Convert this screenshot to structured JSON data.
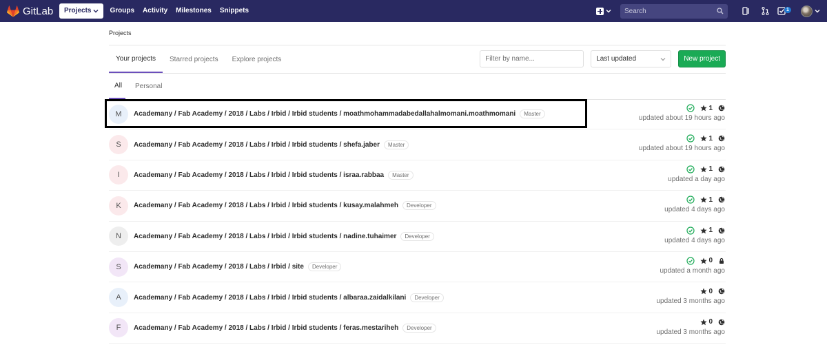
{
  "navbar": {
    "brand": "GitLab",
    "links": [
      "Projects",
      "Groups",
      "Activity",
      "Milestones",
      "Snippets"
    ],
    "search_placeholder": "Search",
    "todo_count": "1",
    "colors": {
      "bg": "#292961",
      "accent": "#fc6d26"
    }
  },
  "breadcrumb": "Projects",
  "tabs": [
    "Your projects",
    "Starred projects",
    "Explore projects"
  ],
  "filter": {
    "placeholder": "Filter by name...",
    "sort_value": "Last updated",
    "new_button": "New project"
  },
  "subtabs": [
    "All",
    "Personal"
  ],
  "projects": [
    {
      "initial": "M",
      "avatar_color": "#e8f0fa",
      "name": "Academany / Fab Academy / 2018 / Labs / Irbid / Irbid students / moathmohammadabedallahalmomani.moathmomani",
      "role": "Master",
      "pipeline": true,
      "stars": "1",
      "visibility": "public",
      "updated": "updated about 19 hours ago"
    },
    {
      "initial": "S",
      "avatar_color": "#fbe9eb",
      "name": "Academany / Fab Academy / 2018 / Labs / Irbid / Irbid students / shefa.jaber",
      "role": "Master",
      "pipeline": true,
      "stars": "1",
      "visibility": "public",
      "updated": "updated about 19 hours ago"
    },
    {
      "initial": "I",
      "avatar_color": "#fbe9eb",
      "name": "Academany / Fab Academy / 2018 / Labs / Irbid / Irbid students / israa.rabbaa",
      "role": "Master",
      "pipeline": true,
      "stars": "1",
      "visibility": "public",
      "updated": "updated a day ago"
    },
    {
      "initial": "K",
      "avatar_color": "#fbe9eb",
      "name": "Academany / Fab Academy / 2018 / Labs / Irbid / Irbid students / kusay.malahmeh",
      "role": "Developer",
      "pipeline": true,
      "stars": "1",
      "visibility": "public",
      "updated": "updated 4 days ago"
    },
    {
      "initial": "N",
      "avatar_color": "#eeeeee",
      "name": "Academany / Fab Academy / 2018 / Labs / Irbid / Irbid students / nadine.tuhaimer",
      "role": "Developer",
      "pipeline": true,
      "stars": "1",
      "visibility": "public",
      "updated": "updated 4 days ago"
    },
    {
      "initial": "S",
      "avatar_color": "#f2e6f7",
      "name": "Academany / Fab Academy / 2018 / Labs / Irbid / site",
      "role": "Developer",
      "pipeline": true,
      "stars": "0",
      "visibility": "private",
      "updated": "updated a month ago"
    },
    {
      "initial": "A",
      "avatar_color": "#e8f0fa",
      "name": "Academany / Fab Academy / 2018 / Labs / Irbid / Irbid students / albaraa.zaidalkilani",
      "role": "Developer",
      "pipeline": false,
      "stars": "0",
      "visibility": "public",
      "updated": "updated 3 months ago"
    },
    {
      "initial": "F",
      "avatar_color": "#f2e6f7",
      "name": "Academany / Fab Academy / 2018 / Labs / Irbid / Irbid students / feras.mestariheh",
      "role": "Developer",
      "pipeline": false,
      "stars": "0",
      "visibility": "public",
      "updated": "updated 3 months ago"
    }
  ]
}
